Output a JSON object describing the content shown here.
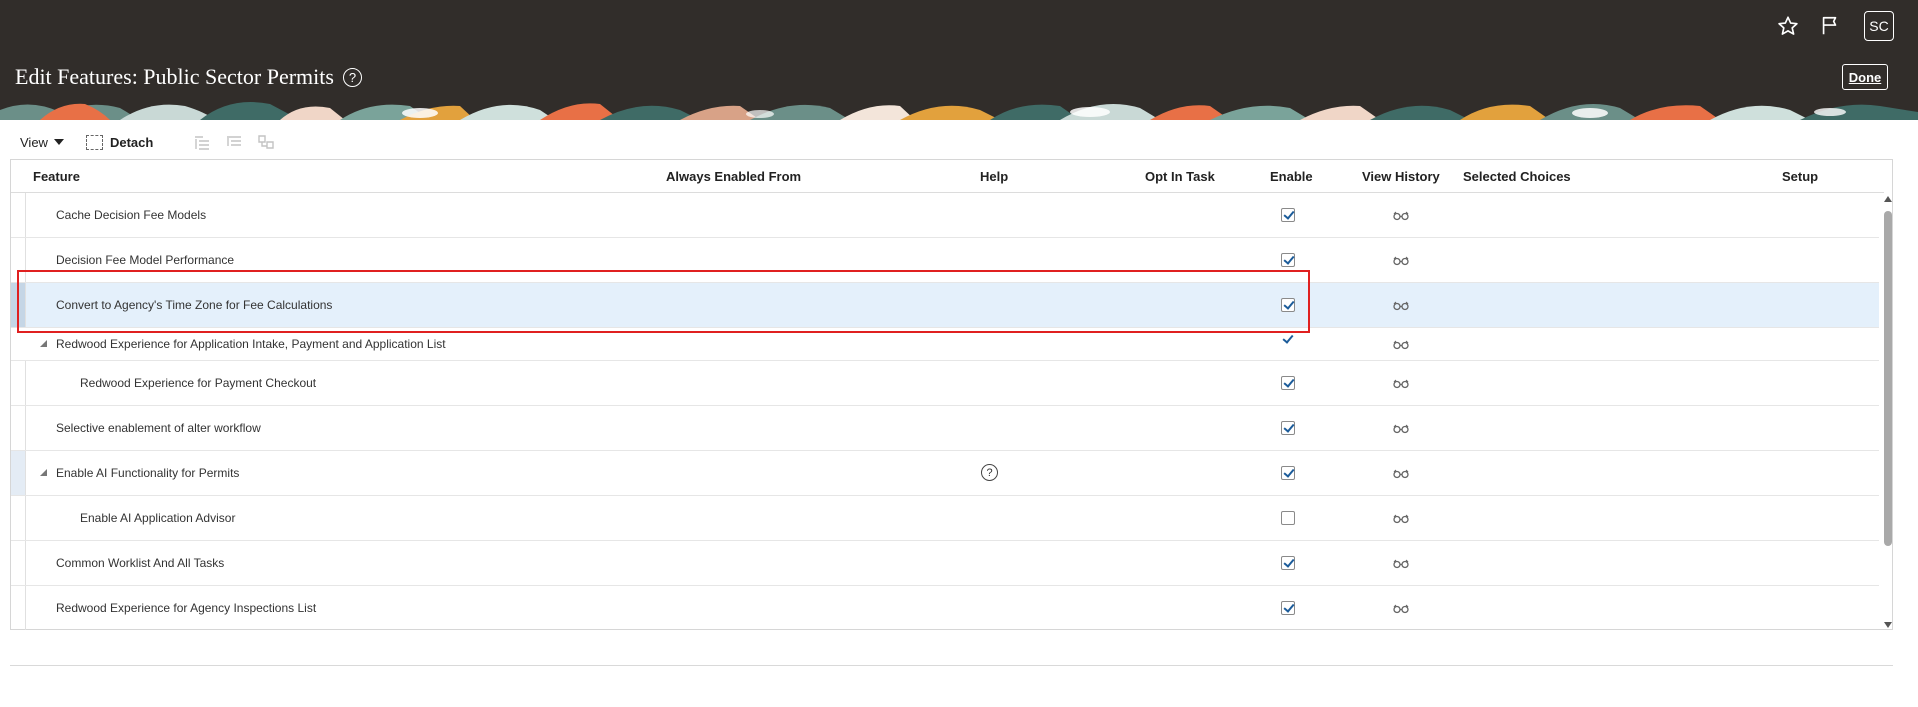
{
  "header": {
    "title": "Edit Features: Public Sector Permits",
    "help_symbol": "?",
    "done_label": "Done",
    "avatar_initials": "SC",
    "icons": [
      "star-icon",
      "flag-icon"
    ],
    "colors": {
      "background": "#312d2a",
      "text": "#ffffff"
    }
  },
  "toolbar": {
    "view_label": "View",
    "detach_label": "Detach"
  },
  "table": {
    "columns": {
      "feature": "Feature",
      "always_enabled_from": "Always Enabled From",
      "help": "Help",
      "opt_in_task": "Opt In Task",
      "enable": "Enable",
      "view_history": "View History",
      "selected_choices": "Selected Choices",
      "setup": "Setup"
    },
    "rows": [
      {
        "feature": "Cache Decision Fee Models",
        "level": 0,
        "enabled": true
      },
      {
        "feature": "Decision Fee Model Performance",
        "level": 0,
        "enabled": true
      },
      {
        "feature": "Convert to Agency's Time Zone for Fee Calculations",
        "level": 0,
        "enabled": true,
        "selected": true
      },
      {
        "feature": "Redwood Experience for Application Intake, Payment and Application List",
        "level": 0,
        "expandable": true,
        "enabled": true
      },
      {
        "feature": "Redwood Experience for Payment Checkout",
        "level": 1,
        "enabled": true
      },
      {
        "feature": "Selective enablement of alter workflow",
        "level": 0,
        "enabled": true
      },
      {
        "feature": "Enable AI Functionality for Permits",
        "level": 0,
        "expandable": true,
        "enabled": true,
        "help": "?"
      },
      {
        "feature": "Enable AI Application Advisor",
        "level": 1,
        "enabled": false
      },
      {
        "feature": "Common Worklist And All Tasks",
        "level": 0,
        "enabled": true
      },
      {
        "feature": "Redwood Experience for Agency Inspections List",
        "level": 0,
        "enabled": true
      }
    ],
    "colors": {
      "selected_row": "#e4f0fb",
      "checkbox_tick": "#1c5c9a",
      "annotation_box": "#e02020"
    }
  }
}
